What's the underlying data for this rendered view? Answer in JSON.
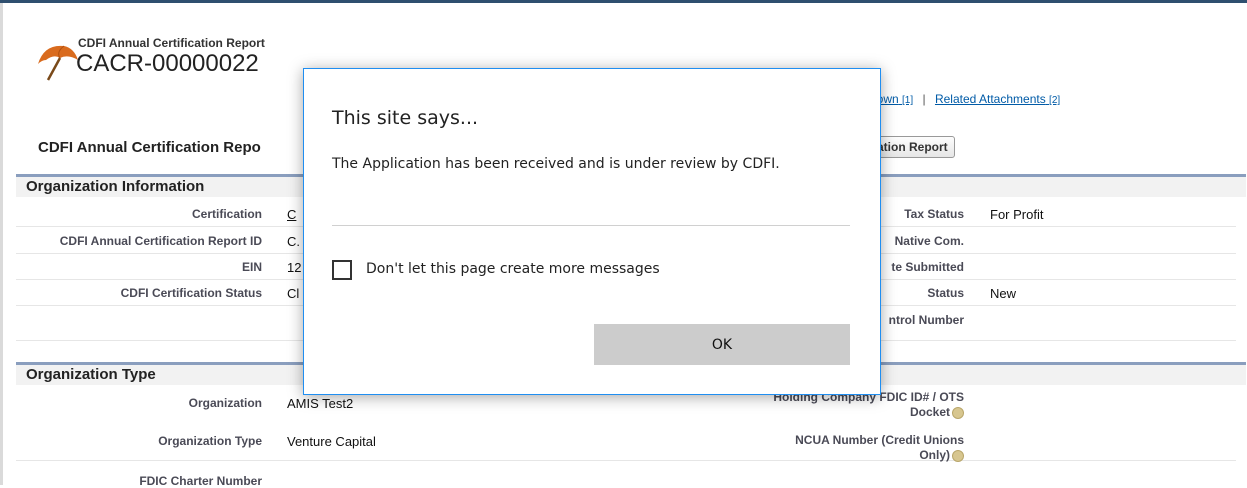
{
  "header": {
    "object_type": "CDFI Annual Certification Report",
    "record_name": "CACR-00000022"
  },
  "related_links": [
    {
      "label": "lown",
      "count": "[1]"
    },
    {
      "label": "Related Attachments",
      "count": "[2]"
    }
  ],
  "page_block": {
    "title": "CDFI Annual Certification Repo",
    "button_label": "ication Report"
  },
  "sections": {
    "org_info": "Organization Information",
    "org_type": "Organization Type"
  },
  "org_info_left": [
    {
      "label": "Certification",
      "value": "C"
    },
    {
      "label": "CDFI Annual Certification Report ID",
      "value": "C."
    },
    {
      "label": "EIN",
      "value": "12"
    },
    {
      "label": "CDFI Certification Status",
      "value": "Cl"
    }
  ],
  "org_info_right": [
    {
      "label": "Tax Status",
      "value": "For Profit"
    },
    {
      "label": "Native Com.",
      "value": ""
    },
    {
      "label": "te Submitted",
      "value": ""
    },
    {
      "label": "Status",
      "value": "New"
    },
    {
      "label": "ntrol Number",
      "value": ""
    }
  ],
  "org_type_left": [
    {
      "label": "Organization",
      "value": "AMIS Test2"
    },
    {
      "label": "Organization Type",
      "value": "Venture Capital"
    },
    {
      "label": "FDIC Charter Number",
      "value": ""
    }
  ],
  "org_type_right": [
    {
      "label_line1": "Holding Company FDIC ID# / OTS",
      "label_line2": "Docket",
      "value": ""
    },
    {
      "label_line1": "NCUA Number (Credit Unions",
      "label_line2": "Only)",
      "value": ""
    }
  ],
  "dialog": {
    "title": "This site says...",
    "message": "The Application has been received and is under review by CDFI.",
    "checkbox_label": "Don't let this page create more messages",
    "ok_label": "OK"
  }
}
